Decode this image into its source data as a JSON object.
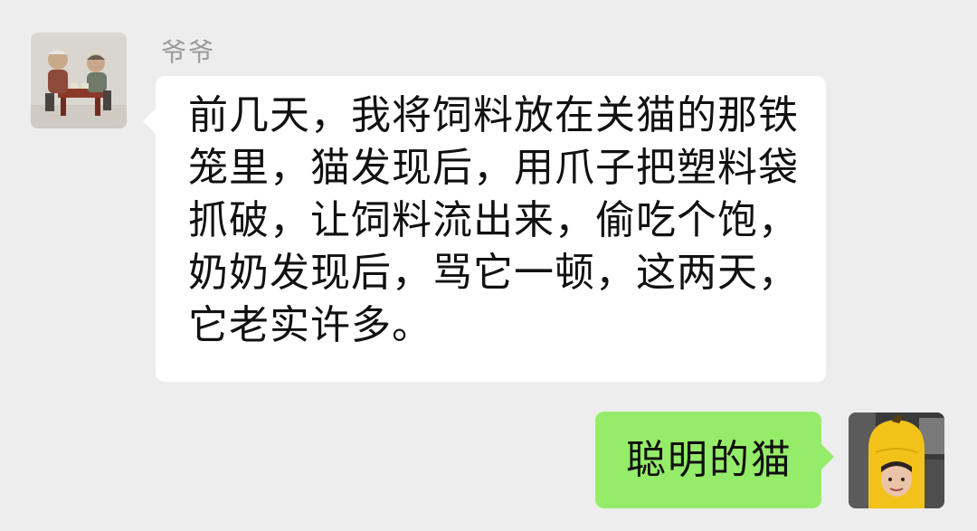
{
  "chat": {
    "incoming": {
      "sender_name": "爷爷",
      "avatar_icon": "grandparents-figurine-avatar",
      "lines": [
        "前几天，我将饲料放在关猫的那铁",
        "笼里，猫发现后，用爪子把塑料袋",
        "抓破，让饲料流出来，偷吃个饱，",
        "奶奶发现后，骂它一顿，这两天，",
        "它老实许多。"
      ]
    },
    "outgoing": {
      "text": "聪明的猫",
      "avatar_icon": "banana-costume-avatar"
    }
  },
  "colors": {
    "background": "#ededed",
    "incoming_bubble": "#ffffff",
    "outgoing_bubble": "#95ec69",
    "sender_name": "#9a9a9a"
  }
}
